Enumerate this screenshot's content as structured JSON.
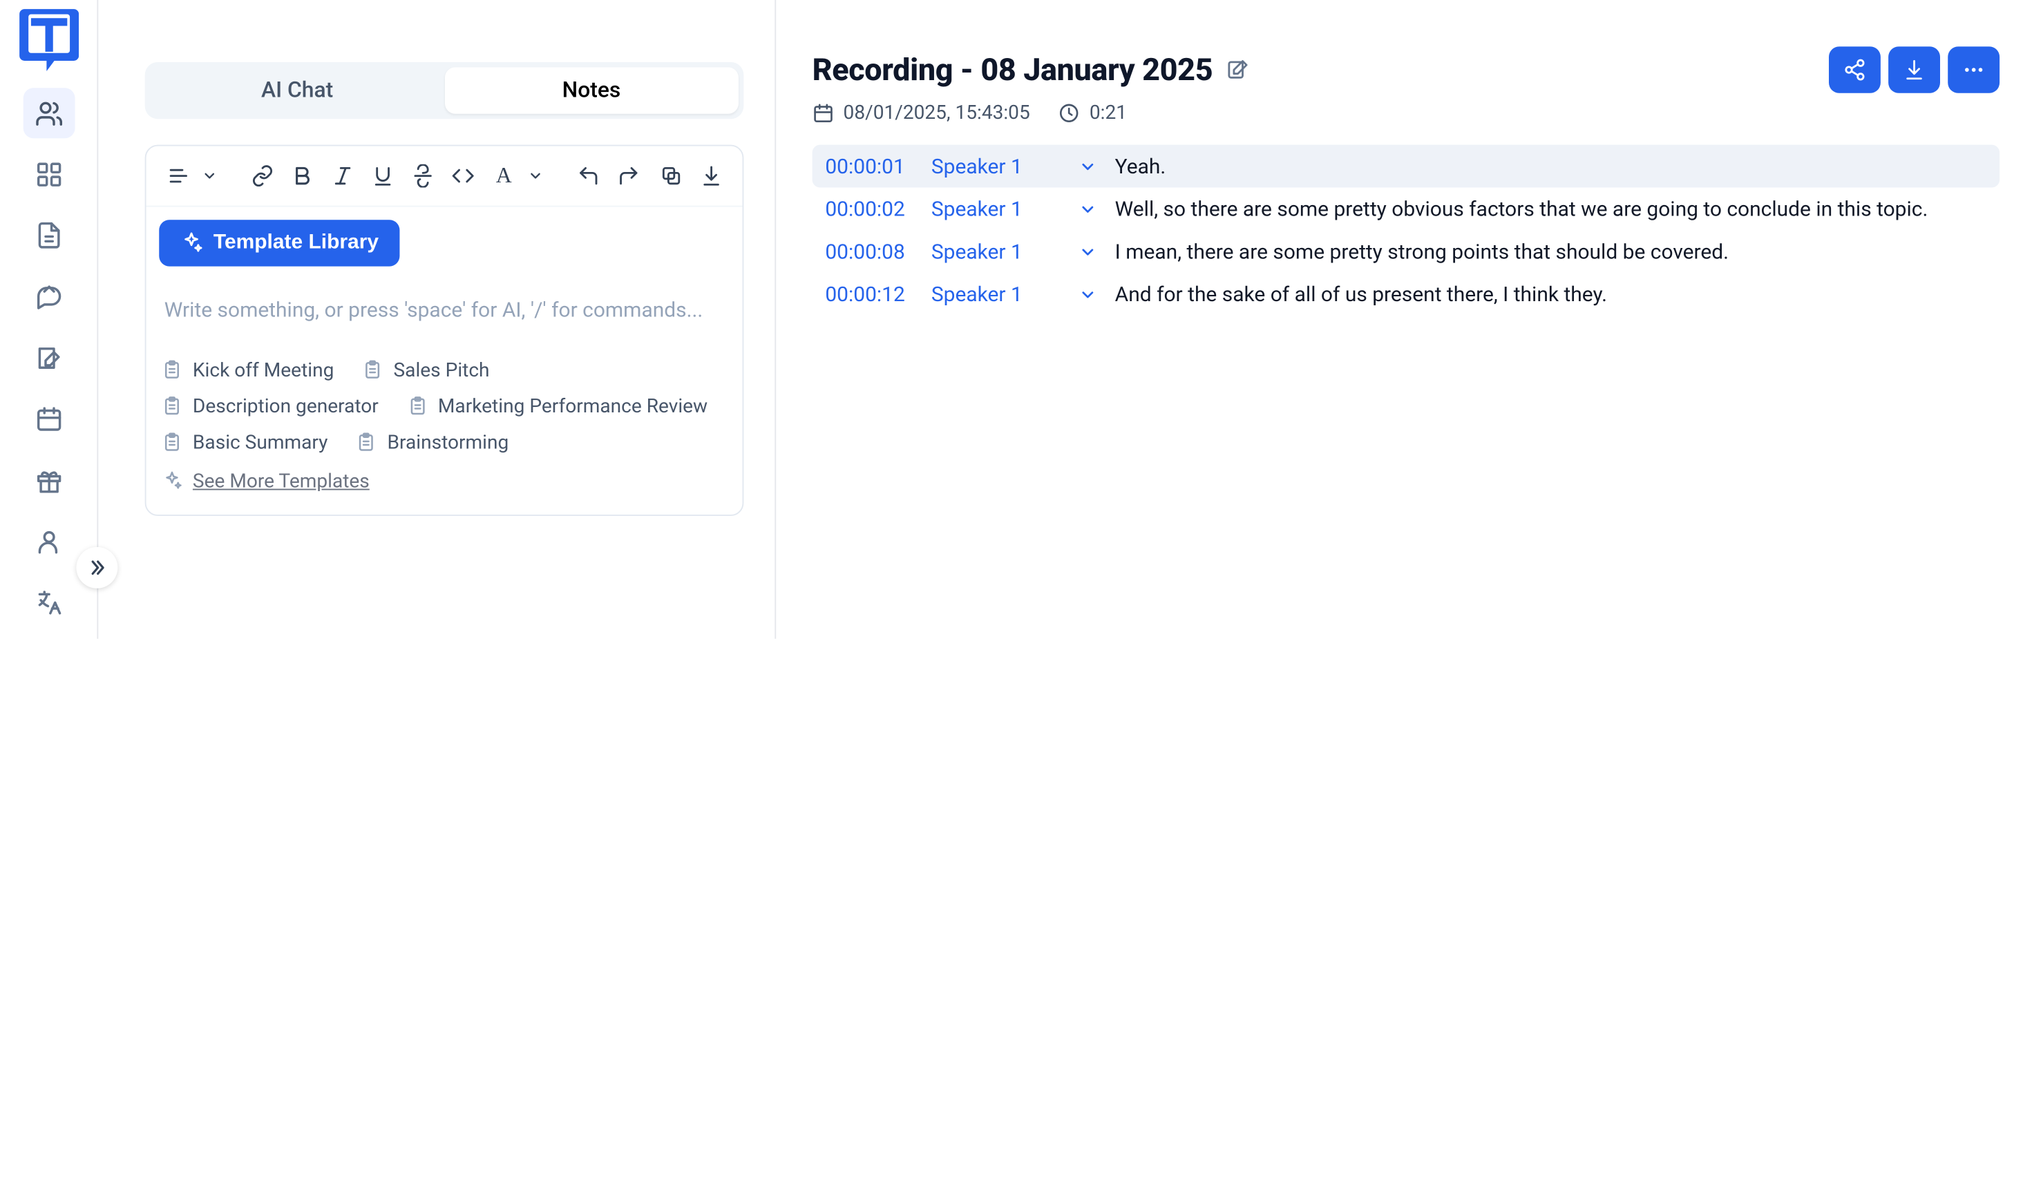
{
  "sidebar": {
    "items": [
      {
        "name": "people"
      },
      {
        "name": "dashboard"
      },
      {
        "name": "document"
      },
      {
        "name": "chat"
      },
      {
        "name": "notes"
      },
      {
        "name": "calendar"
      },
      {
        "name": "gift"
      },
      {
        "name": "user"
      },
      {
        "name": "translate"
      }
    ]
  },
  "middle": {
    "tabs": {
      "ai_chat": "AI Chat",
      "notes": "Notes"
    },
    "template_library_label": "Template Library",
    "editor_placeholder": "Write something, or press 'space' for AI, '/' for commands...",
    "templates": [
      "Kick off Meeting",
      "Sales Pitch",
      "Description generator",
      "Marketing Performance Review",
      "Basic Summary",
      "Brainstorming"
    ],
    "see_more_label": "See More Templates"
  },
  "recording": {
    "title": "Recording - 08 January 2025",
    "date_time": "08/01/2025, 15:43:05",
    "duration": "0:21",
    "lines": [
      {
        "ts": "00:00:01",
        "speaker": "Speaker 1",
        "text": "Yeah.",
        "active": true
      },
      {
        "ts": "00:00:02",
        "speaker": "Speaker 1",
        "text": "Well, so there are some pretty obvious factors that we are going to conclude in this topic.",
        "active": false
      },
      {
        "ts": "00:00:08",
        "speaker": "Speaker 1",
        "text": "I mean, there are some pretty strong points that should be covered.",
        "active": false
      },
      {
        "ts": "00:00:12",
        "speaker": "Speaker 1",
        "text": "And for the sake of all of us present there, I think they.",
        "active": false
      }
    ]
  }
}
